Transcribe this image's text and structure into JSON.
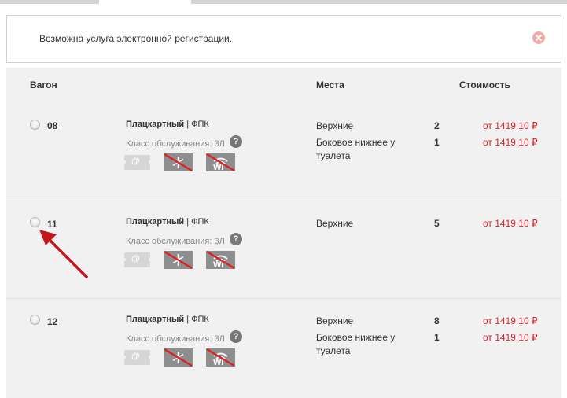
{
  "notice": {
    "text": "Возможна услуга электронной регистрации."
  },
  "table": {
    "headers": {
      "wagon": "Вагон",
      "seats": "Места",
      "price": "Стоимость"
    },
    "rows": [
      {
        "number": "08",
        "type": "Плацкартный",
        "sep": " | ",
        "carrier": "ФПК",
        "service_class": "Класс обслуживания: 3Л",
        "help": "?",
        "ereg_label": "@",
        "seats": [
          {
            "name": "Верхние",
            "count": "2",
            "price": "от 1419.10 ₽"
          },
          {
            "name": "Боковое нижнее у туалета",
            "count": "1",
            "price": "от 1419.10 ₽"
          }
        ]
      },
      {
        "number": "11",
        "type": "Плацкартный",
        "sep": " | ",
        "carrier": "ФПК",
        "service_class": "Класс обслуживания: 3Л",
        "help": "?",
        "ereg_label": "@",
        "seats": [
          {
            "name": "Верхние",
            "count": "5",
            "price": "от 1419.10 ₽"
          }
        ]
      },
      {
        "number": "12",
        "type": "Плацкартный",
        "sep": " | ",
        "carrier": "ФПК",
        "service_class": "Класс обслуживания: 3Л",
        "help": "?",
        "ereg_label": "@",
        "seats": [
          {
            "name": "Верхние",
            "count": "8",
            "price": "от 1419.10 ₽"
          },
          {
            "name": "Боковое нижнее у туалета",
            "count": "1",
            "price": "от 1419.10 ₽"
          }
        ]
      }
    ]
  },
  "icons": {
    "close": "close-circle-icon",
    "help": "question-icon",
    "ereg": "electronic-registration-icon",
    "ac": "no-air-conditioning-icon",
    "wifi": "no-wifi-icon",
    "annotation": "red-arrow-icon"
  },
  "colors": {
    "price": "#d9262c",
    "table_bg": "#f1f1f1",
    "close": "#f0a8a8",
    "strike": "#e02020",
    "arrow": "#c0161c"
  }
}
